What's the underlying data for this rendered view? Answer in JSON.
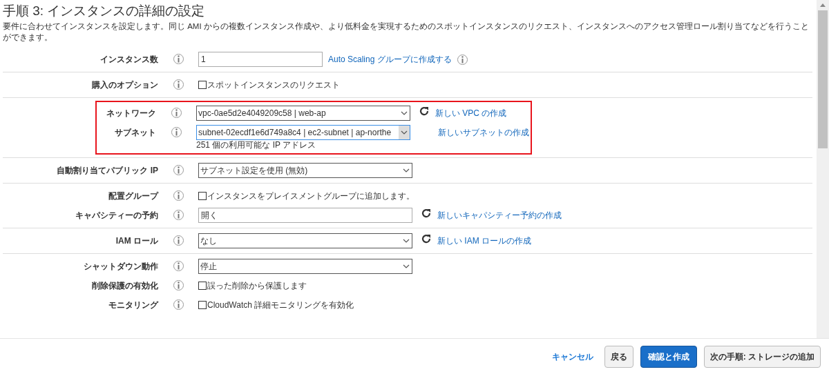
{
  "title": "手順 3: インスタンスの詳細の設定",
  "description": "要件に合わせてインスタンスを設定します。同じ AMI からの複数インスタンス作成や、より低料金を実現するためのスポットインスタンスのリクエスト、インスタンスへのアクセス管理ロール割り当てなどを行うことができます。",
  "groups": [
    {
      "highlighted": false,
      "rows": [
        {
          "kind": "input",
          "label": "インスタンス数",
          "value": "1",
          "link": "Auto Scaling グループに作成する",
          "link_info": true,
          "refresh": false
        }
      ]
    },
    {
      "highlighted": false,
      "rows": [
        {
          "kind": "checkbox",
          "label": "購入のオプション",
          "text": "スポットインスタンスのリクエスト",
          "checked": false
        }
      ]
    },
    {
      "highlighted": true,
      "rows": [
        {
          "kind": "select",
          "label": "ネットワーク",
          "value": "vpc-0ae5d2e4049209c58 | web-ap",
          "link": "新しい VPC の作成",
          "refresh": true,
          "focused": false
        },
        {
          "kind": "select",
          "label": "サブネット",
          "value": "subnet-02ecdf1e6d749a8c4 | ec2-subnet | ap-northe",
          "link": "新しいサブネットの作成",
          "refresh": false,
          "focused": true,
          "note": "251 個の利用可能な IP アドレス"
        }
      ]
    },
    {
      "highlighted": false,
      "rows": [
        {
          "kind": "select",
          "label": "自動割り当てパブリック IP",
          "value": "サブネット設定を使用 (無効)",
          "refresh": false,
          "focused": false
        }
      ]
    },
    {
      "highlighted": false,
      "rows": [
        {
          "kind": "checkbox",
          "label": "配置グループ",
          "text": "インスタンスをプレイスメントグループに追加します。",
          "checked": false
        },
        {
          "kind": "input",
          "label": "キャパシティーの予約",
          "value": "開く",
          "link": "新しいキャパシティー予約の作成",
          "refresh": true,
          "link_info": false,
          "wide": true
        }
      ]
    },
    {
      "highlighted": false,
      "rows": [
        {
          "kind": "select",
          "label": "IAM ロール",
          "value": "なし",
          "link": "新しい IAM ロールの作成",
          "refresh": true,
          "focused": false
        }
      ]
    },
    {
      "highlighted": false,
      "rows": [
        {
          "kind": "select",
          "label": "シャットダウン動作",
          "value": "停止",
          "refresh": false,
          "focused": false
        },
        {
          "kind": "checkbox",
          "label": "削除保護の有効化",
          "text": "誤った削除から保護します",
          "checked": false
        },
        {
          "kind": "checkbox",
          "label": "モニタリング",
          "text": "CloudWatch 詳細モニタリングを有効化",
          "checked": false
        }
      ]
    }
  ],
  "footer": [
    {
      "kind": "link",
      "label": "キャンセル"
    },
    {
      "kind": "default",
      "label": "戻る"
    },
    {
      "kind": "primary",
      "label": "確認と作成"
    },
    {
      "kind": "default",
      "label": "次の手順: ストレージの追加"
    }
  ]
}
